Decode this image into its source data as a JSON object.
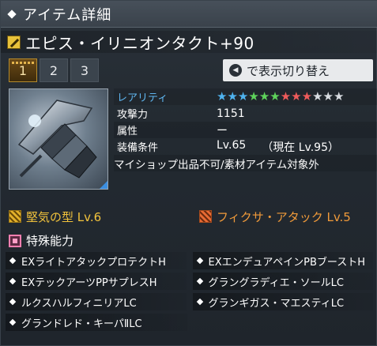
{
  "header": {
    "title": "アイテム詳細"
  },
  "item": {
    "name": "エピス・イリニオンタクト+90"
  },
  "tabs": [
    {
      "label": "1"
    },
    {
      "label": "2"
    },
    {
      "label": "3"
    }
  ],
  "toggle": {
    "label": "で表示切り替え"
  },
  "stats": {
    "rarity_label": "レアリティ",
    "stars": [
      {
        "color": "#4fb3ef"
      },
      {
        "color": "#4fb3ef"
      },
      {
        "color": "#4fb3ef"
      },
      {
        "color": "#5ed35b"
      },
      {
        "color": "#5ed35b"
      },
      {
        "color": "#5ed35b"
      },
      {
        "color": "#ef5b5b"
      },
      {
        "color": "#ef5b5b"
      },
      {
        "color": "#ef5b5b"
      },
      {
        "color": "#d9dde2"
      },
      {
        "color": "#d9dde2"
      },
      {
        "color": "#d9dde2"
      }
    ],
    "attack_label": "攻撃力",
    "attack_value": "1151",
    "element_label": "属性",
    "element_value": "ー",
    "equip_label": "装備条件",
    "equip_level": "Lv.65",
    "equip_current": "（現在 Lv.95）",
    "note": "マイショップ出品不可/素材アイテム対象外"
  },
  "potentials": {
    "left": "堅気の型 Lv.6",
    "right": "フィクサ・アタック Lv.5"
  },
  "abilities_title": "特殊能力",
  "abilities": [
    [
      "EXライトアタックプロテクトH",
      "EXエンデュアペインPBブーストH"
    ],
    [
      "EXテックアーツPPサプレスH",
      "グラングラディエ・ソールLC"
    ],
    [
      "ルクスハルフィニリアLC",
      "グランギガス・マエスティLC"
    ],
    [
      "グランドレド・キーパⅡLC",
      ""
    ]
  ]
}
